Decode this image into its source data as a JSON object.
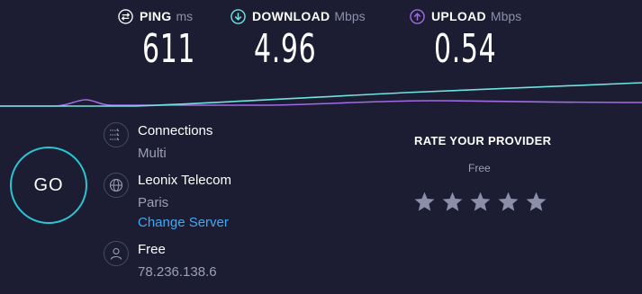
{
  "ping": {
    "label": "PING",
    "unit": "ms",
    "value": "611",
    "icon": "ping-icon"
  },
  "download": {
    "label": "DOWNLOAD",
    "unit": "Mbps",
    "value": "4.96",
    "icon": "download-arrow-icon"
  },
  "upload": {
    "label": "UPLOAD",
    "unit": "Mbps",
    "value": "0.54",
    "icon": "upload-arrow-icon"
  },
  "colors": {
    "background": "#1c1d33",
    "download_accent": "#6fe3e1",
    "upload_accent": "#a36ae5",
    "go_ring": "#2bc5d2",
    "link": "#3fa9f5",
    "muted_text": "#9c9fb8",
    "star": "#8b8ea6"
  },
  "go": {
    "label": "GO"
  },
  "connections": {
    "title": "Connections",
    "value": "Multi",
    "icon": "connections-icon"
  },
  "server": {
    "name": "Leonix Telecom",
    "location": "Paris",
    "change_label": "Change Server",
    "icon": "globe-icon"
  },
  "client": {
    "isp": "Free",
    "ip": "78.236.138.6",
    "icon": "user-icon"
  },
  "rating": {
    "title": "RATE YOUR PROVIDER",
    "isp": "Free",
    "stars": 5,
    "selected": 0
  }
}
